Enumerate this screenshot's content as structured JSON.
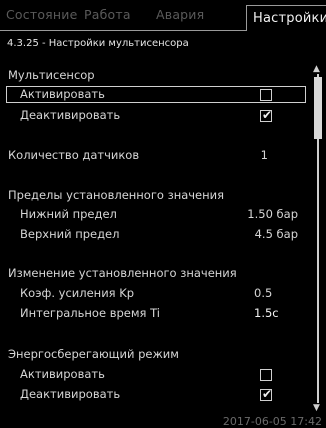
{
  "tabs": [
    {
      "label": "Состояние",
      "active": false
    },
    {
      "label": "Работа",
      "active": false
    },
    {
      "label": "Авария",
      "active": false
    },
    {
      "label": "Настройки",
      "active": true
    }
  ],
  "breadcrumb": "4.3.25 - Настройки мультисенсора",
  "section_multisensor": {
    "title": "Мультисенсор",
    "activate": {
      "label": "Активировать",
      "checked": false
    },
    "deactivate": {
      "label": "Деактивировать",
      "checked": true
    }
  },
  "sensor_count": {
    "label": "Количество датчиков",
    "value": "1"
  },
  "setpoint_limits": {
    "title": "Пределы установленного значения",
    "lower": {
      "label": "Нижний предел",
      "value": "1.50 бар"
    },
    "upper": {
      "label": "Верхний предел",
      "value": "4.5 бар"
    }
  },
  "setpoint_change": {
    "title": "Изменение установленного значения",
    "kp": {
      "label": "Коэф. усиления Kp",
      "value": "0.5"
    },
    "ti": {
      "label": "Интегральное время Ti",
      "value": "1.5с"
    }
  },
  "energy_saving": {
    "title": "Энергосберегающий режим",
    "activate": {
      "label": "Активировать",
      "checked": false
    },
    "deactivate": {
      "label": "Деактивировать",
      "checked": true
    }
  },
  "check_glyph": "✔",
  "scroll": {
    "up": "▲",
    "down": "▼"
  },
  "timestamp": "2017-06-05 17:42",
  "colors": {
    "background": "#000000",
    "text": "#d6d6d6",
    "inactive_tab": "#5a5a5a"
  }
}
